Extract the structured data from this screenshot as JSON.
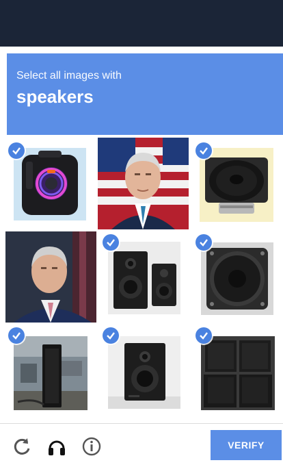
{
  "header": {
    "instruction": "Select all images with",
    "object": "speakers"
  },
  "tiles": [
    {
      "name": "portable-party-speaker",
      "selected": true
    },
    {
      "name": "politician-portrait-flag",
      "selected": false
    },
    {
      "name": "raw-speaker-driver",
      "selected": true
    },
    {
      "name": "politician-portrait-dark",
      "selected": false
    },
    {
      "name": "bookshelf-speaker-pair",
      "selected": true
    },
    {
      "name": "round-speaker-driver",
      "selected": true
    },
    {
      "name": "outdoor-column-speaker",
      "selected": true
    },
    {
      "name": "studio-monitor-speaker",
      "selected": true
    },
    {
      "name": "stacked-pa-speakers",
      "selected": true
    }
  ],
  "footer": {
    "verify_label": "VERIFY",
    "icons": [
      "reload-icon",
      "headphones-icon",
      "info-icon"
    ]
  },
  "colors": {
    "accent": "#5b8ee6",
    "check": "#4a82e0",
    "top_bar": "#1b2537"
  }
}
